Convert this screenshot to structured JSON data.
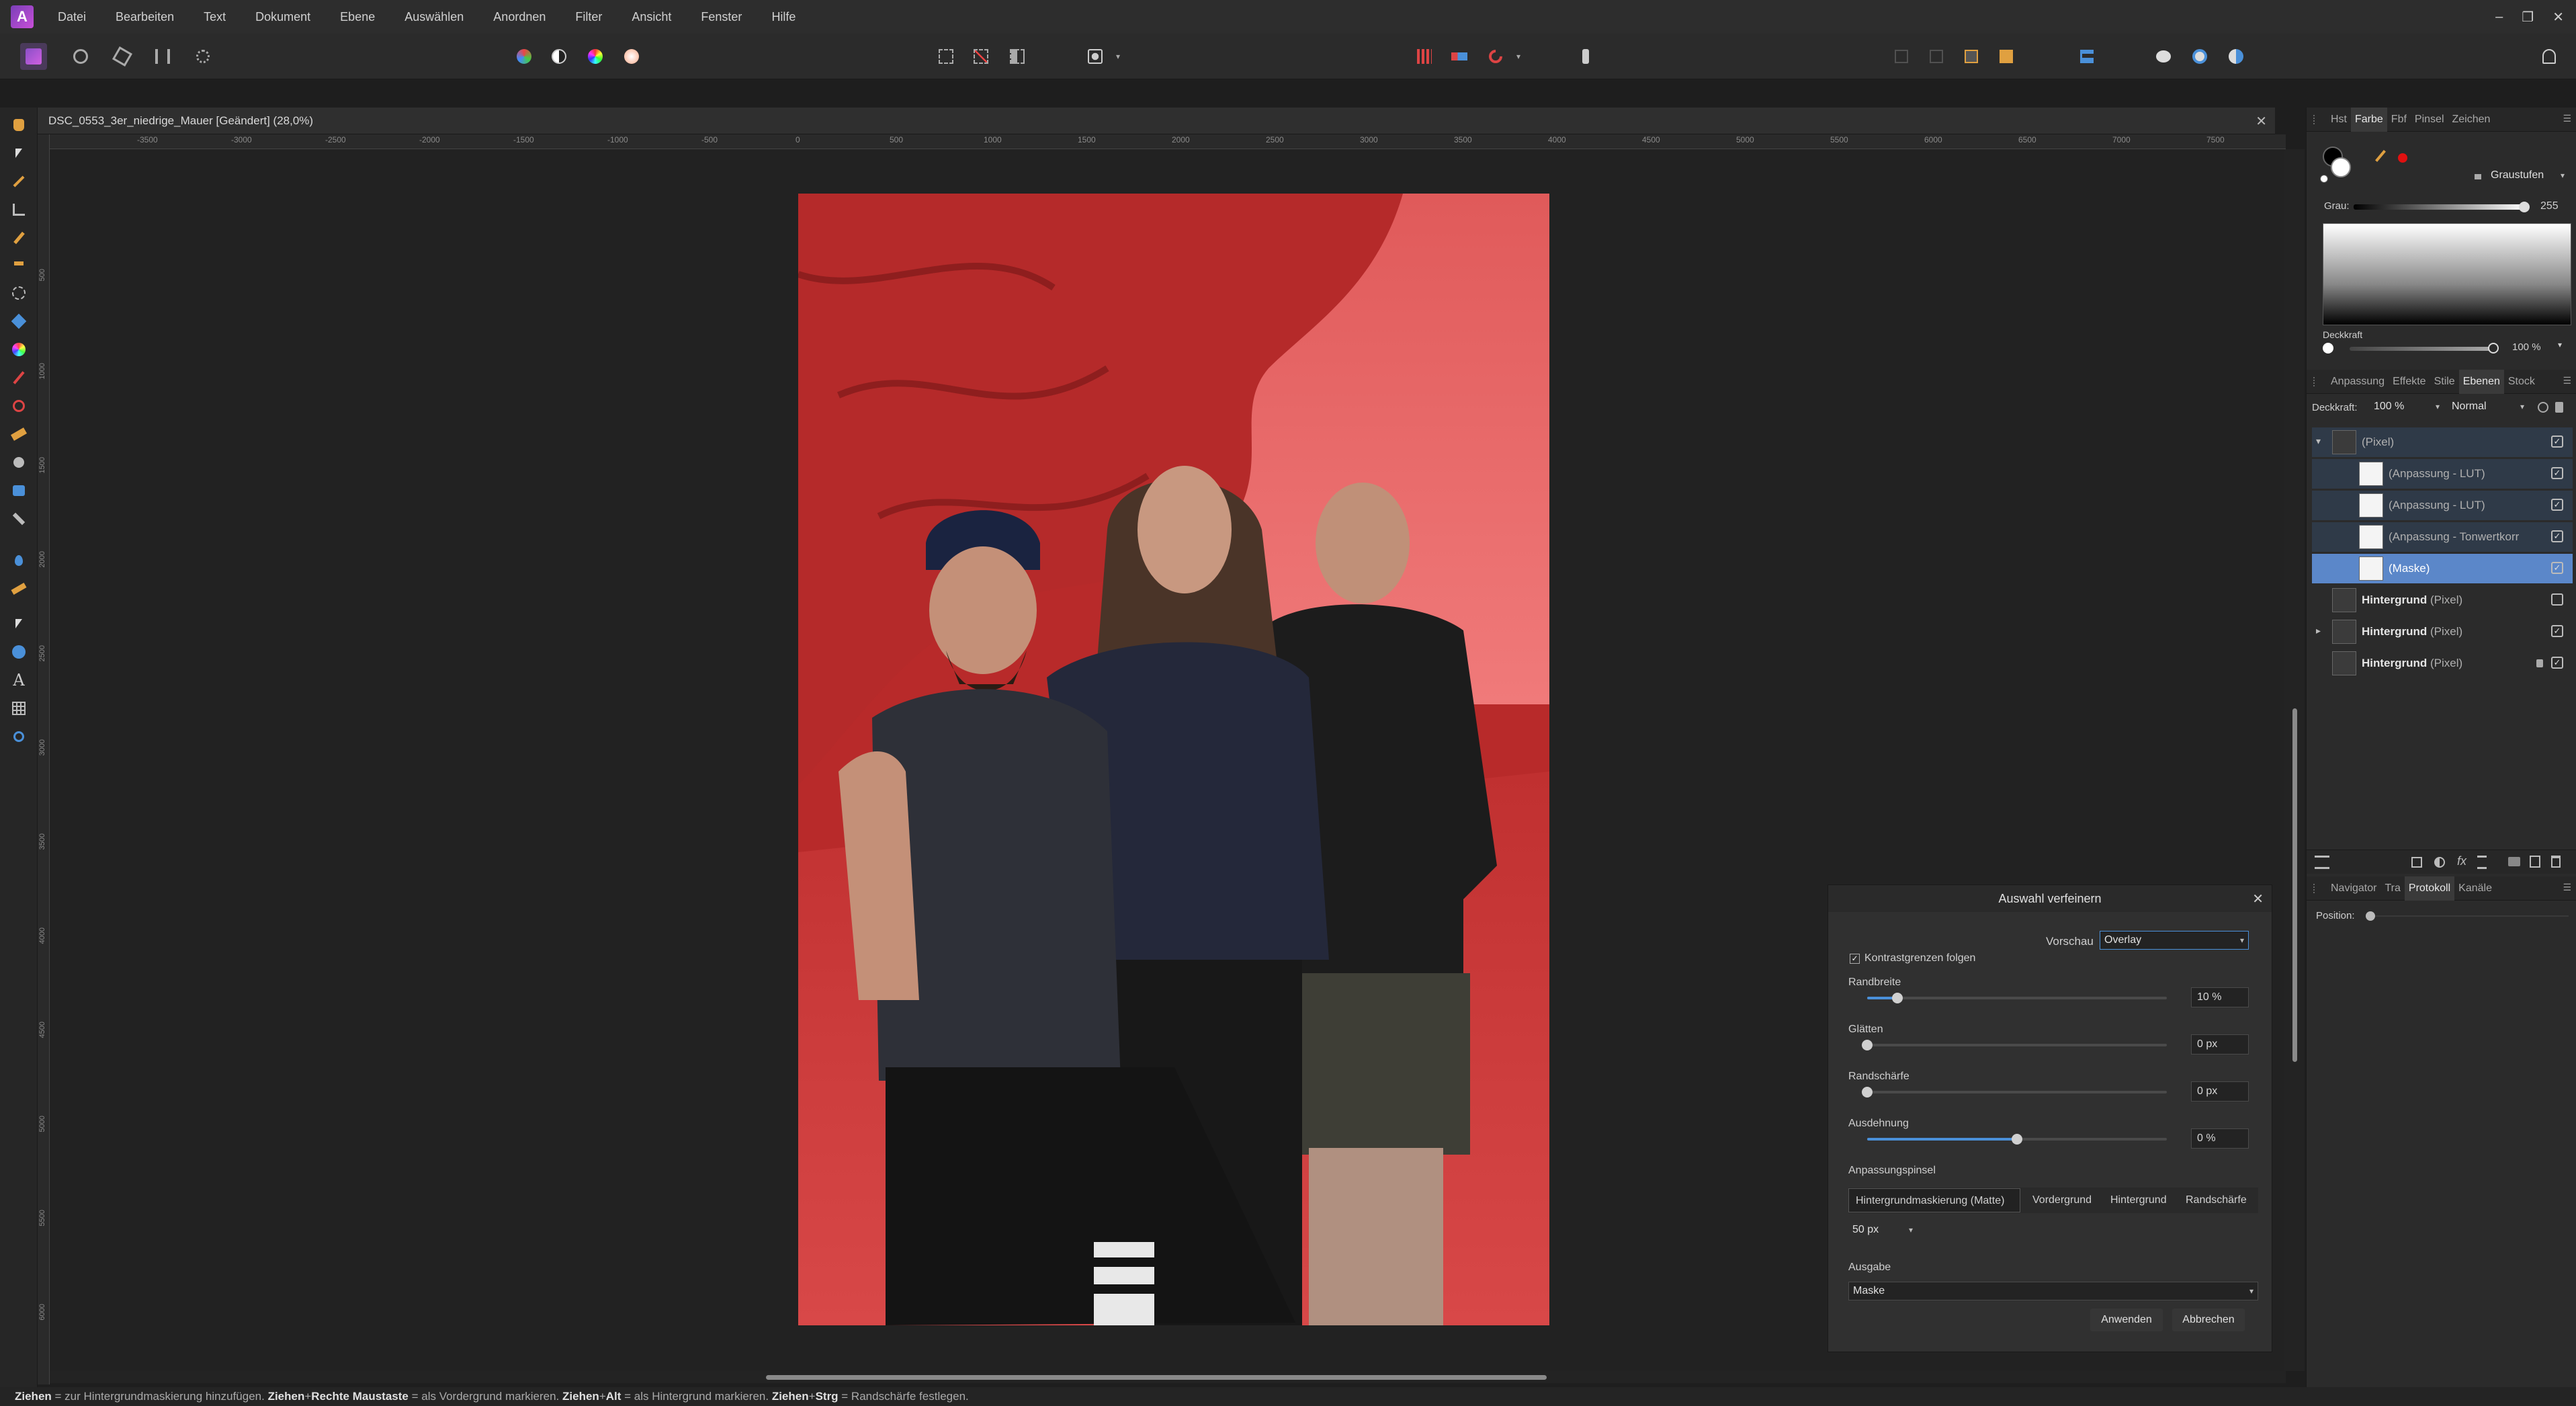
{
  "menu": [
    "Datei",
    "Bearbeiten",
    "Text",
    "Dokument",
    "Ebene",
    "Auswählen",
    "Anordnen",
    "Filter",
    "Ansicht",
    "Fenster",
    "Hilfe"
  ],
  "window_controls": [
    "–",
    "❐",
    "✕"
  ],
  "document": {
    "title": "DSC_0553_3er_niedrige_Mauer [Geändert] (28,0%)",
    "close": "✕"
  },
  "ruler_h": [
    "-3500",
    "-3000",
    "-2500",
    "-2000",
    "-1500",
    "-1000",
    "-500",
    "0",
    "500",
    "1000",
    "1500",
    "2000",
    "2500",
    "3000",
    "3500",
    "4000",
    "4500",
    "5000",
    "5500",
    "6000",
    "6500",
    "7000",
    "7500"
  ],
  "ruler_v": [
    "500",
    "1000",
    "1500",
    "2000",
    "2500",
    "3000",
    "3500",
    "4000",
    "4500",
    "5000",
    "5500",
    "6000"
  ],
  "colors": {
    "accent": "#4a90d9",
    "overlay_red": "#c23636",
    "selected_layer": "#5b87c9"
  },
  "color_panel": {
    "tabs": [
      "Hst",
      "Farbe",
      "Fbf",
      "Pinsel",
      "Zeichen"
    ],
    "active_tab": "Farbe",
    "mode": "Graustufen",
    "gray_label": "Grau:",
    "gray_value": "255",
    "opacity_label": "Deckkraft",
    "opacity_value": "100 %"
  },
  "layers_panel": {
    "tabs": [
      "Anpassung",
      "Effekte",
      "Stile",
      "Ebenen",
      "Stock"
    ],
    "active_tab": "Ebenen",
    "opacity_label": "Deckkraft:",
    "opacity_value": "100 %",
    "blend_mode": "Normal",
    "layers": [
      {
        "name": "",
        "type": "(Pixel)",
        "checked": true
      },
      {
        "name": "",
        "type": "(Anpassung - LUT)",
        "checked": true
      },
      {
        "name": "",
        "type": "(Anpassung - LUT)",
        "checked": true
      },
      {
        "name": "",
        "type": "(Anpassung - Tonwertkorr",
        "checked": true
      },
      {
        "name": "",
        "type": "(Maske)",
        "checked": true,
        "selected": true
      },
      {
        "name": "Hintergrund",
        "type": "(Pixel)",
        "checked": false
      },
      {
        "name": "Hintergrund",
        "type": "(Pixel)",
        "checked": true
      },
      {
        "name": "Hintergrund",
        "type": "(Pixel)",
        "checked": true,
        "locked": true
      }
    ]
  },
  "nav_panel": {
    "tabs": [
      "Navigator",
      "Tra",
      "Protokoll",
      "Kanäle"
    ],
    "active_tab": "Protokoll",
    "position_label": "Position:"
  },
  "refine": {
    "title": "Auswahl verfeinern",
    "preview_label": "Vorschau",
    "preview_value": "Overlay",
    "contrast_label": "Kontrastgrenzen folgen",
    "contrast_checked": true,
    "sliders": [
      {
        "label": "Randbreite",
        "value": "10 %",
        "fraction": 0.1
      },
      {
        "label": "Glätten",
        "value": "0 px",
        "fraction": 0.0
      },
      {
        "label": "Randschärfe",
        "value": "0 px",
        "fraction": 0.0
      },
      {
        "label": "Ausdehnung",
        "value": "0 %",
        "fraction": 0.5
      }
    ],
    "brush_label": "Anpassungspinsel",
    "brush_modes": [
      "Hintergrundmaskierung (Matte)",
      "Vordergrund",
      "Hintergrund",
      "Randschärfe"
    ],
    "brush_active": "Hintergrundmaskierung (Matte)",
    "brush_size": "50 px",
    "output_label": "Ausgabe",
    "output_value": "Maske",
    "apply": "Anwenden",
    "cancel": "Abbrechen"
  },
  "status": {
    "k1": "Ziehen",
    "t1": " = zur Hintergrundmaskierung hinzufügen. ",
    "k2": "Ziehen",
    "k2b": "+",
    "k2c": "Rechte Maustaste",
    "t2": " = als Vordergrund markieren. ",
    "k3": "Ziehen",
    "k3b": "+",
    "k3c": "Alt",
    "t3": " = als Hintergrund markieren. ",
    "k4": "Ziehen",
    "k4b": "+",
    "k4c": "Strg",
    "t4": " = Randschärfe festlegen."
  }
}
